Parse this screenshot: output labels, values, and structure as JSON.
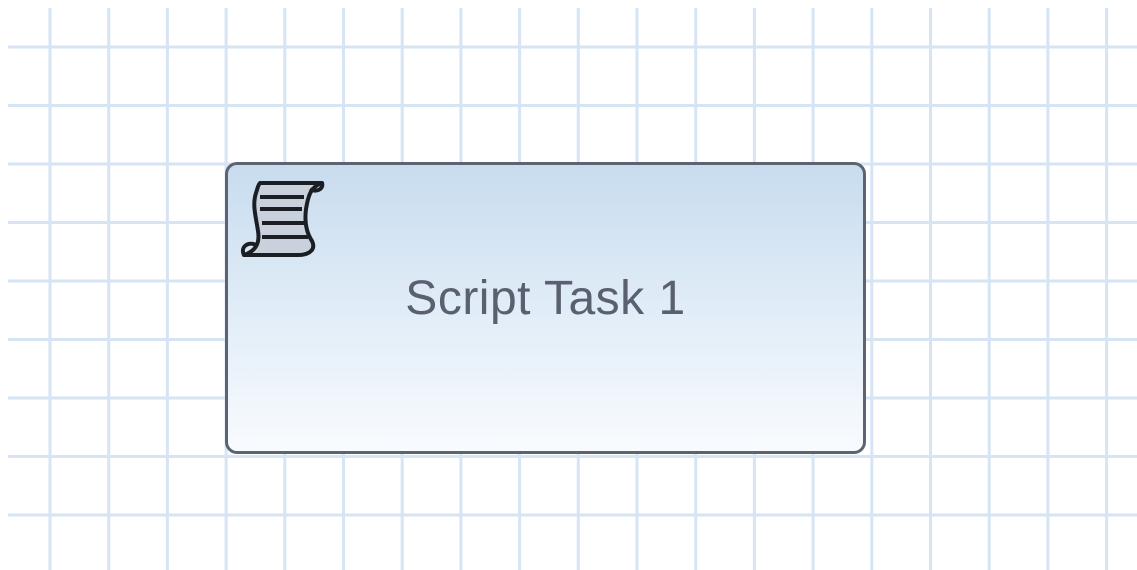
{
  "diagram": {
    "grid_color": "#d6e4f3",
    "task": {
      "type": "script-task",
      "label": "Script Task 1",
      "icon": "script-scroll-icon",
      "fill_top": "#c8dcee",
      "fill_bottom": "#f8fbfe",
      "border_color": "#5b6470"
    }
  }
}
